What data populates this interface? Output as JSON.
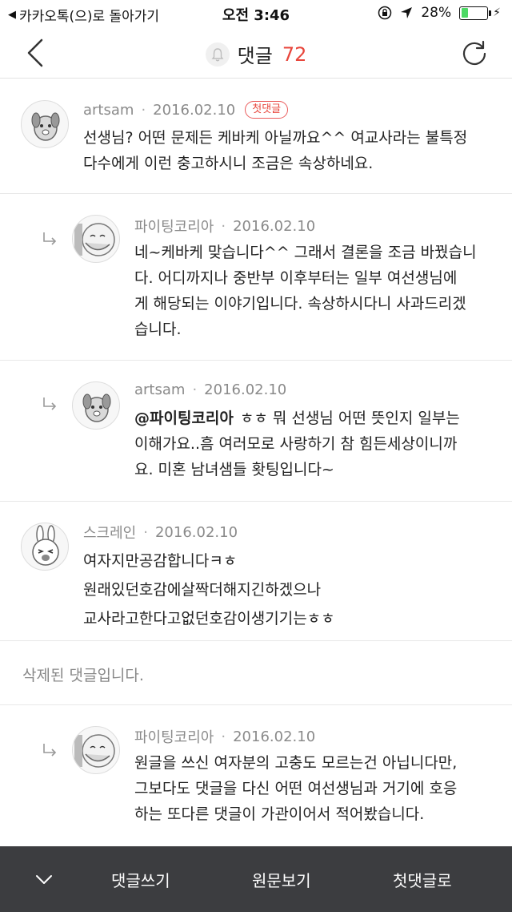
{
  "status_bar": {
    "back_to_app": "카카오톡(으)로 돌아가기",
    "time": "오전 3:46",
    "battery": "28%",
    "battery_level": 0.28
  },
  "header": {
    "title": "댓글",
    "count": "72"
  },
  "comments": [
    {
      "author": "artsam",
      "date": "2016.02.10",
      "badge": "첫댓글",
      "lines": [
        "선생님? 어떤 문제든 케바케 아닐까요^^ 여교사라는 불특정",
        "다수에게 이런 충고하시니 조금은 속상하네요."
      ]
    },
    {
      "author": "파이팅코리아",
      "date": "2016.02.10",
      "lines": [
        "네~케바케 맞습니다^^ 그래서 결론을 조금 바꿨습니",
        "다. 어디까지나 중반부 이후부터는 일부 여선생님에",
        "게 해당되는 이야기입니다. 속상하시다니 사과드리겠",
        "습니다."
      ]
    },
    {
      "author": "artsam",
      "date": "2016.02.10",
      "mention": "@파이팅코리아",
      "lines": [
        "ㅎㅎ 뭐 선생님 어떤 뜻인지 일부는",
        "이해가요..흠 여러모로 사랑하기 참 힘든세상이니까",
        "요. 미혼 남녀샘들 홧팅입니다~"
      ]
    },
    {
      "author": "스크레인",
      "date": "2016.02.10",
      "lines": [
        "여자지만공감합니다ㅋㅎ",
        "원래있던호감에살짝더해지긴하겠으나",
        "교사라고한다고없던호감이생기기는ㅎㅎ"
      ]
    },
    {
      "deleted_text": "삭제된 댓글입니다."
    },
    {
      "author": "파이팅코리아",
      "date": "2016.02.10",
      "lines": [
        "원글을 쓰신 여자분의 고충도 모르는건 아닙니다만,",
        "그보다도 댓글을 다신 어떤 여선생님과 거기에 호응",
        "하는 또다른 댓글이 가관이어서 적어봤습니다."
      ]
    }
  ],
  "bottom_bar": {
    "write": "댓글쓰기",
    "view_original": "원문보기",
    "first_comment": "첫댓글로"
  }
}
